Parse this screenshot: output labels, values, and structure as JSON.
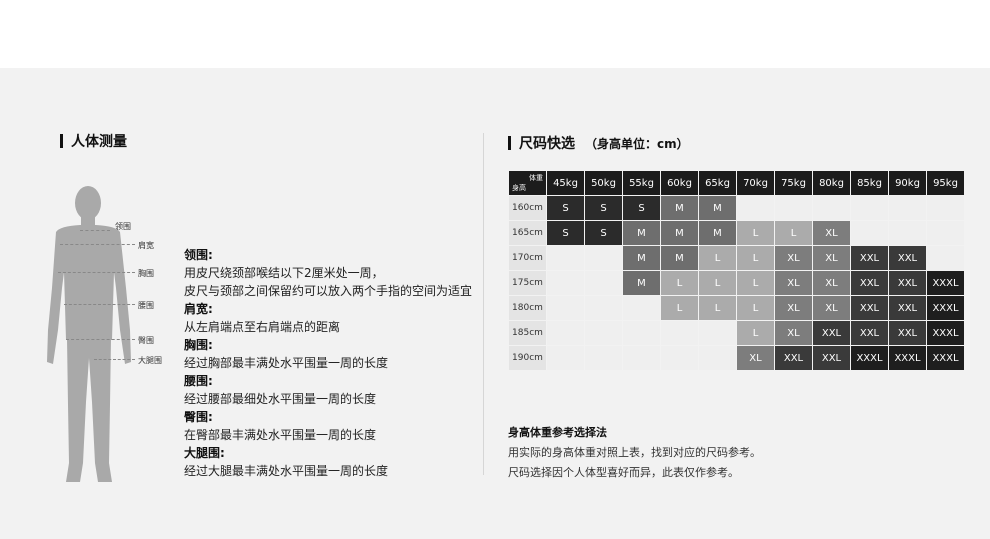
{
  "left": {
    "title": "人体测量",
    "labels": [
      "领围",
      "肩宽",
      "胸围",
      "腰围",
      "臀围",
      "大腿围"
    ],
    "definitions": [
      {
        "term": "领围:",
        "desc1": "用皮尺绕颈部喉结以下2厘米处一周，",
        "desc2": "皮尺与颈部之间保留约可以放入两个手指的空间为适宜"
      },
      {
        "term": "肩宽:",
        "desc1": "从左肩端点至右肩端点的距离",
        "desc2": ""
      },
      {
        "term": "胸围:",
        "desc1": "经过胸部最丰满处水平围量一周的长度",
        "desc2": ""
      },
      {
        "term": "腰围:",
        "desc1": "经过腰部最细处水平围量一周的长度",
        "desc2": ""
      },
      {
        "term": "臀围:",
        "desc1": "在臀部最丰满处水平围量一周的长度",
        "desc2": ""
      },
      {
        "term": "大腿围:",
        "desc1": "经过大腿最丰满处水平围量一周的长度",
        "desc2": ""
      }
    ]
  },
  "right": {
    "title": "尺码快选",
    "subtitle": "（身高单位：cm）",
    "corner_weight": "体重",
    "corner_height": "身高",
    "weights": [
      "45kg",
      "50kg",
      "55kg",
      "60kg",
      "65kg",
      "70kg",
      "75kg",
      "80kg",
      "85kg",
      "90kg",
      "95kg"
    ],
    "heights": [
      "160cm",
      "165cm",
      "170cm",
      "175cm",
      "180cm",
      "185cm",
      "190cm"
    ],
    "rows": [
      [
        "S",
        "S",
        "S",
        "M",
        "M",
        "",
        "",
        "",
        "",
        "",
        ""
      ],
      [
        "S",
        "S",
        "M",
        "M",
        "M",
        "L",
        "L",
        "XL",
        "",
        "",
        ""
      ],
      [
        "",
        "",
        "M",
        "M",
        "L",
        "L",
        "XL",
        "XL",
        "XXL",
        "XXL",
        ""
      ],
      [
        "",
        "",
        "M",
        "L",
        "L",
        "L",
        "XL",
        "XL",
        "XXL",
        "XXL",
        "XXXL"
      ],
      [
        "",
        "",
        "",
        "L",
        "L",
        "L",
        "XL",
        "XL",
        "XXL",
        "XXL",
        "XXXL"
      ],
      [
        "",
        "",
        "",
        "",
        "",
        "L",
        "XL",
        "XXL",
        "XXL",
        "XXL",
        "XXXL"
      ],
      [
        "",
        "",
        "",
        "",
        "",
        "XL",
        "XXL",
        "XXL",
        "XXXL",
        "XXXL",
        "XXXL"
      ]
    ],
    "colors": {
      "S": "#2b2b2b",
      "M": "#6e6e6e",
      "L": "#ababab",
      "XL": "#7d7d7d",
      "XXL": "#3a3a3a",
      "XXXL": "#1e1e1e",
      "empty": "#efefef",
      "header": "#1c1c1c"
    },
    "note_title": "身高体重参考选择法",
    "note_line1": "用实际的身高体重对照上表，找到对应的尺码参考。",
    "note_line2": "尺码选择因个人体型喜好而异，此表仅作参考。"
  }
}
